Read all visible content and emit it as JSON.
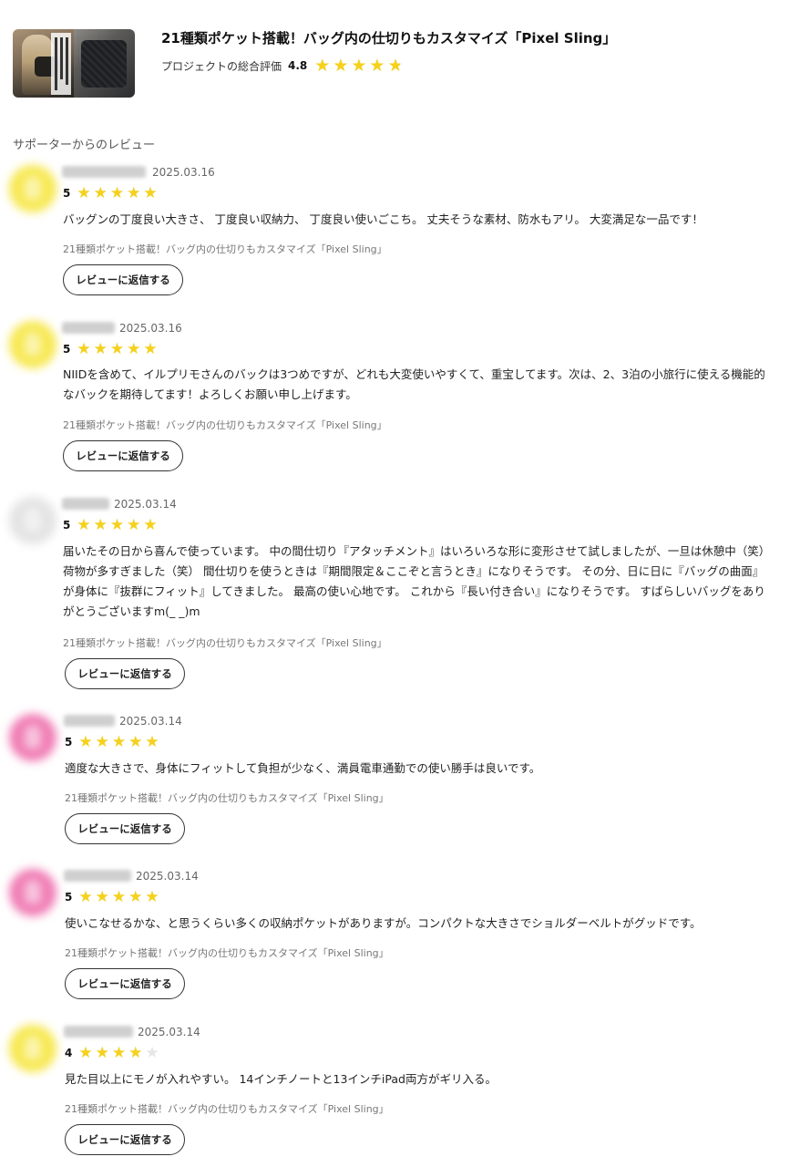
{
  "project": {
    "title": "21種類ポケット搭載！バッグ内の仕切りもカスタマイズ「Pixel Sling」",
    "rating_label": "プロジェクトの総合評価",
    "rating_value": "4.8",
    "rating_stars": 4.8
  },
  "section_title": "サポーターからのレビュー",
  "colors": {
    "star_filled": "#f5d11a",
    "star_empty": "#e6e6e6",
    "avatar_yellow": "#f7e850",
    "avatar_pink": "#f07cb4",
    "avatar_gray": "#e3e3e3"
  },
  "reviews": [
    {
      "avatar_color": "yellow",
      "date": "2025.03.16",
      "score": "5",
      "stars": 5,
      "body": "バッグンの丁度良い大きさ、 丁度良い収納力、 丁度良い使いごこち。 丈夫そうな素材、防水もアリ。 大変満足な一品です！",
      "project_link": "21種類ポケット搭載！バッグ内の仕切りもカスタマイズ「Pixel Sling」",
      "reply_label": "レビューに返信する"
    },
    {
      "avatar_color": "yellow",
      "date": "2025.03.16",
      "score": "5",
      "stars": 5,
      "body": "NIIDを含めて、イルプリモさんのバックは3つめですが、どれも大変使いやすくて、重宝してます。次は、2、3泊の小旅行に使える機能的なバックを期待してます！よろしくお願い申し上げます。",
      "project_link": "21種類ポケット搭載！バッグ内の仕切りもカスタマイズ「Pixel Sling」",
      "reply_label": "レビューに返信する"
    },
    {
      "avatar_color": "gray",
      "date": "2025.03.14",
      "score": "5",
      "stars": 5,
      "body": "届いたその日から喜んで使っています。 中の間仕切り『アタッチメント』はいろいろな形に変形させて試しましたが、一旦は休憩中（笑）荷物が多すぎました（笑） 間仕切りを使うときは『期間限定＆ここぞと言うとき』になりそうです。 その分、日に日に『バッグの曲面』が身体に『抜群にフィット』してきました。 最高の使い心地です。 これから『長い付き合い』になりそうです。 すばらしいバッグをありがとうございますm(_ _)m",
      "project_link": "21種類ポケット搭載！バッグ内の仕切りもカスタマイズ「Pixel Sling」",
      "reply_label": "レビューに返信する"
    },
    {
      "avatar_color": "pink",
      "date": "2025.03.14",
      "score": "5",
      "stars": 5,
      "body": "適度な大きさで、身体にフィットして負担が少なく、満員電車通勤での使い勝手は良いです。",
      "project_link": "21種類ポケット搭載！バッグ内の仕切りもカスタマイズ「Pixel Sling」",
      "reply_label": "レビューに返信する"
    },
    {
      "avatar_color": "pink",
      "date": "2025.03.14",
      "score": "5",
      "stars": 5,
      "body": "使いこなせるかな、と思うくらい多くの収納ポケットがありますが。コンパクトな大きさでショルダーベルトがグッドです。",
      "project_link": "21種類ポケット搭載！バッグ内の仕切りもカスタマイズ「Pixel Sling」",
      "reply_label": "レビューに返信する"
    },
    {
      "avatar_color": "yellow",
      "date": "2025.03.14",
      "score": "4",
      "stars": 4,
      "body": "見た目以上にモノが入れやすい。 14インチノートと13インチiPad両方がギリ入る。",
      "project_link": "21種類ポケット搭載！バッグ内の仕切りもカスタマイズ「Pixel Sling」",
      "reply_label": "レビューに返信する"
    }
  ]
}
